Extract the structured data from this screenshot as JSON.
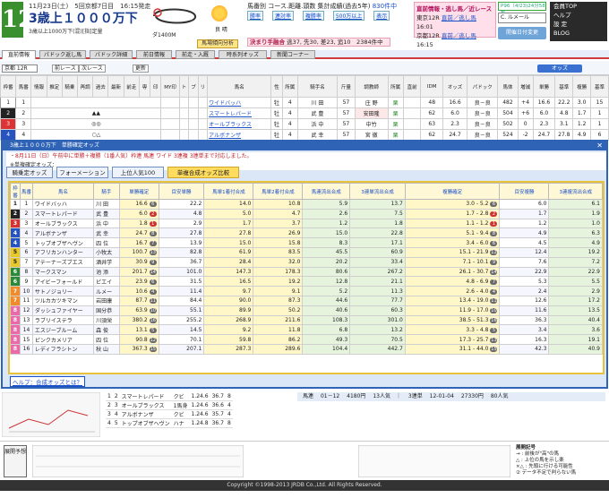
{
  "header": {
    "race_number": "12",
    "date_line": "11月23日(土)　5回京都7日目　16:15発走",
    "race_name": "3歳上１０００万下",
    "condition": "3歳以上1000万下(混)[指]定量",
    "distance": "ダ1400M",
    "track_state": "良 晴",
    "analysis_button": "馬場傾向分析",
    "info_title_prefix": "馬番別 コース.距離.頭数 集計成績(過去5年)",
    "info_link": "830件中",
    "info_buttons": [
      "勝率",
      "連対率",
      "複勝率",
      "500万以上",
      "表示"
    ],
    "rules": "",
    "kimarite_label": "決まり手融合",
    "kimarite_text": "逃37, 先30, 差23, 追10　2384件中",
    "next_race_title": "直前情報・逃し馬／近レース",
    "next_races": [
      {
        "venue": "東京12R",
        "link": "直前／逃し馬",
        "time": "16:01"
      },
      {
        "venue": "京都12R",
        "link": "直前／逃し馬",
        "time": "16:15"
      }
    ],
    "timer": "P96（4/23)24分58秒",
    "user_select": "C. ルメール",
    "kaisai_button": "開催日付変更",
    "side_buttons": [
      "会員TOP",
      "ヘルプ",
      "設 定",
      "BLOG"
    ]
  },
  "tabs": [
    "直前情報",
    "パドック返し馬",
    "パドック詳細",
    "前日情報",
    "前走・入厩",
    "時系列オッズ",
    "新聞コーナー"
  ],
  "subbar": {
    "venue": "京都 12R",
    "prev": "前レース",
    "next": "次レース",
    "update": "更新",
    "odds": "オッズ"
  },
  "main_headers": [
    "枠番",
    "馬番",
    "情報",
    "推定",
    "騎乗",
    "再調",
    "過去",
    "最新",
    "前走",
    "専",
    "印",
    "MY印",
    "ト",
    "ブ",
    "リ",
    "馬名",
    "性",
    "所属",
    "騎手名",
    "斤量",
    "調教師",
    "所属",
    "直前",
    "IDM",
    "オッズ",
    "パドック",
    "馬体",
    "増減",
    "単勝",
    "基準",
    "複勝",
    "基準"
  ],
  "main_rows": [
    {
      "waku": "1",
      "uma": "1",
      "marks": "",
      "name": "ワイドバッハ",
      "sex": "牡",
      "shozoku": "4",
      "jockey": "川 田",
      "weight": "57",
      "trainer": "庄 野",
      "tb": "栗",
      "idm": "48",
      "odds": "16.6",
      "pad": "良－良",
      "bodyw": "482",
      "diff": "+4",
      "tan": "16.6",
      "kijun": "22.2",
      "fuku": "3.0",
      "kfuku": "15"
    },
    {
      "waku": "2",
      "uma": "2",
      "marks": "▲▲",
      "name": "スマートレパード",
      "sex": "牡",
      "shozoku": "4",
      "jockey": "武 豊",
      "weight": "57",
      "trainer": "安田隆",
      "tb": "栗",
      "idm": "62",
      "odds": "6.0",
      "pad": "良－良",
      "bodyw": "504",
      "diff": "+6",
      "tan": "6.0",
      "kijun": "4.8",
      "fuku": "1.7",
      "kfuku": "1"
    },
    {
      "waku": "3",
      "uma": "3",
      "marks": "◎◎",
      "name": "オールブラックス",
      "sex": "牡",
      "shozoku": "4",
      "jockey": "浜 中",
      "weight": "57",
      "trainer": "中竹",
      "tb": "栗",
      "idm": "63",
      "odds": "2.3",
      "pad": "良－良",
      "bodyw": "502",
      "diff": "0",
      "tan": "2.3",
      "kijun": "3.1",
      "fuku": "1.2",
      "kfuku": "1"
    },
    {
      "waku": "4",
      "uma": "4",
      "marks": "○△",
      "name": "アルボナンザ",
      "sex": "牡",
      "shozoku": "4",
      "jockey": "武 幸",
      "weight": "57",
      "trainer": "宮 徹",
      "tb": "栗",
      "idm": "62",
      "odds": "24.7",
      "pad": "良－良",
      "bodyw": "524",
      "diff": "-2",
      "tan": "24.7",
      "kijun": "27.8",
      "fuku": "4.9",
      "kfuku": "6"
    }
  ],
  "panel": {
    "title": "3歳上１０００万下　単勝確定オッズ",
    "info_line_a": "・8月11日（日）午前中に単勝＋複勝（1番人気）枠連 馬連 ワイド 3連複 3連単まで対応しました。",
    "info_line_b": "※単複確定オッズ：",
    "tabs": [
      "騎乗定オッズ",
      "フォーメーション",
      "上位人気100",
      "単複合成オッズ比較"
    ],
    "help": "ヘルプ：合成オッズとは？"
  },
  "grid": {
    "headers": [
      "枠番",
      "馬番",
      "馬名",
      "騎手",
      "単勝確定",
      "目安単勝",
      "馬単1着付合成",
      "馬単2着付合成",
      "馬連流出合成",
      "3連単流出合成",
      "複勝確定",
      "目安複勝",
      "3連複流出合成"
    ],
    "rows": [
      {
        "w": "1",
        "u": "1",
        "name": "ワイドバッハ",
        "jockey": "川 田",
        "tan": "16.6",
        "mrk1": "6",
        "mt": "22.2",
        "mb1": "14.0",
        "mr1": "5",
        "mb2": "10.8",
        "mr2": "6",
        "ren": "5.9",
        "rr": "6",
        "s3": "13.7",
        "fk": "3.0 - 5.2",
        "fr": "6",
        "mf": "6.0",
        "s3f": "6.1",
        "frr": "6"
      },
      {
        "w": "2",
        "u": "2",
        "name": "スマートレパード",
        "jockey": "武 豊",
        "tan": "6.0",
        "mrk1": "2",
        "mt": "4.8",
        "mb1": "5.0",
        "mr1": "2",
        "mb2": "4.7",
        "mr2": "3",
        "ren": "2.6",
        "rr": "2",
        "s3": "7.5",
        "fk": "1.7 - 2.8",
        "fr": "2",
        "mf": "1.7",
        "s3f": "1.9",
        "frr": "3"
      },
      {
        "w": "3",
        "u": "3",
        "name": "オールブラックス",
        "jockey": "浜 中",
        "tan": "1.8",
        "mrk1": "1",
        "mt": "2.9",
        "mb1": "1.7",
        "mr1": "1",
        "mb2": "3.7",
        "mr2": "1",
        "ren": "1.2",
        "rr": "1",
        "s3": "1.8",
        "fk": "1.1 - 1.2",
        "fr": "1",
        "mf": "1.2",
        "s3f": "1.0",
        "frr": "1"
      },
      {
        "w": "4",
        "u": "4",
        "name": "アルボナンザ",
        "jockey": "武 幸",
        "tan": "24.7",
        "mrk1": "8",
        "mt": "27.8",
        "mb1": "27.8",
        "mr1": "8",
        "mb2": "26.9",
        "mr2": "9",
        "ren": "15.0",
        "rr": "8",
        "s3": "22.8",
        "fk": "5.1 - 9.4",
        "fr": "8",
        "mf": "4.9",
        "s3f": "6.3",
        "frr": "6"
      },
      {
        "w": "4",
        "u": "5",
        "name": "トップオブザヘヴン",
        "jockey": "四 位",
        "tan": "16.7",
        "mrk1": "7",
        "mt": "13.9",
        "mb1": "15.0",
        "mr1": "6",
        "mb2": "15.8",
        "mr2": "6",
        "ren": "8.3",
        "rr": "7",
        "s3": "17.1",
        "fk": "3.4 - 6.0",
        "fr": "6",
        "mf": "4.5",
        "s3f": "4.9",
        "frr": "7"
      },
      {
        "w": "5",
        "u": "6",
        "name": "アフリカンハンター",
        "jockey": "小牧太",
        "tan": "100.7",
        "mrk1": "13",
        "mt": "82.8",
        "mb1": "61.9",
        "mr1": "12",
        "mb2": "83.5",
        "mr2": "13",
        "ren": "45.5",
        "rr": "13",
        "s3": "60.9",
        "fk": "15.1 - 21.9",
        "fr": "12",
        "mf": "12.4",
        "s3f": "19.2",
        "frr": "13"
      },
      {
        "w": "5",
        "u": "7",
        "name": "アテーナーズブエス",
        "jockey": "酒井学",
        "tan": "30.9",
        "mrk1": "9",
        "mt": "36.7",
        "mb1": "28.4",
        "mr1": "9",
        "mb2": "32.0",
        "mr2": "10",
        "ren": "20.2",
        "rr": "10",
        "s3": "33.4",
        "fk": "7.1 - 10.1",
        "fr": "9",
        "mf": "7.6",
        "s3f": "7.2",
        "frr": "9"
      },
      {
        "w": "6",
        "u": "8",
        "name": "マークスマン",
        "jockey": "池 添",
        "tan": "201.7",
        "mrk1": "14",
        "mt": "101.0",
        "mb1": "147.3",
        "mr1": "14",
        "mb2": "178.3",
        "mr2": "14",
        "ren": "80.6",
        "rr": "14",
        "s3": "267.2",
        "fk": "26.1 - 30.7",
        "fr": "14",
        "mf": "22.9",
        "s3f": "22.9",
        "frr": "14"
      },
      {
        "w": "6",
        "u": "9",
        "name": "アイビーフォールド",
        "jockey": "ピエイ",
        "tan": "23.9",
        "mrk1": "6",
        "mt": "31.5",
        "mb1": "16.5",
        "mr1": "7",
        "mb2": "19.2",
        "mr2": "8",
        "ren": "12.8",
        "rr": "8",
        "s3": "21.1",
        "fk": "4.8 - 6.9",
        "fr": "7",
        "mf": "5.3",
        "s3f": "5.5",
        "frr": "7"
      },
      {
        "w": "7",
        "u": "10",
        "name": "サトノジョリー",
        "jockey": "ルメー",
        "tan": "10.6",
        "mrk1": "4",
        "mt": "11.4",
        "mb1": "9.7",
        "mr1": "4",
        "mb2": "9.1",
        "mr2": "4",
        "ren": "5.2",
        "rr": "4",
        "s3": "11.3",
        "fk": "2.6 - 4.0",
        "fr": "4",
        "mf": "2.4",
        "s3f": "2.9",
        "frr": "4"
      },
      {
        "w": "7",
        "u": "11",
        "name": "ツルカカツキマン",
        "jockey": "岩田康",
        "tan": "87.7",
        "mrk1": "11",
        "mt": "84.4",
        "mb1": "90.0",
        "mr1": "11",
        "mb2": "87.3",
        "mr2": "12",
        "ren": "44.6",
        "rr": "11",
        "s3": "77.7",
        "fk": "13.4 - 19.0",
        "fr": "11",
        "mf": "12.6",
        "s3f": "17.2",
        "frr": "12"
      },
      {
        "w": "8",
        "u": "12",
        "name": "ダッシュファイヤー",
        "jockey": "国分恭",
        "tan": "63.9",
        "mrk1": "10",
        "mt": "55.1",
        "mb1": "89.9",
        "mr1": "10",
        "mb2": "50.2",
        "mr2": "11",
        "ren": "40.6",
        "rr": "10",
        "s3": "60.3",
        "fk": "11.9 - 17.0",
        "fr": "10",
        "mf": "11.6",
        "s3f": "13.5",
        "frr": "10"
      },
      {
        "w": "8",
        "u": "13",
        "name": "ラブリイステラ",
        "jockey": "川須栄",
        "tan": "380.2",
        "mrk1": "16",
        "mt": "255.2",
        "mb1": "268.9",
        "mr1": "16",
        "mb2": "211.6",
        "mr2": "16",
        "ren": "108.3",
        "rr": "16",
        "s3": "301.0",
        "fk": "38.5 - 51.3",
        "fr": "16",
        "mf": "36.3",
        "s3f": "40.4",
        "frr": "16"
      },
      {
        "w": "8",
        "u": "14",
        "name": "エスジーブルーム",
        "jockey": "森 俊",
        "tan": "13.1",
        "mrk1": "5",
        "mt": "14.5",
        "mb1": "9.2",
        "mr1": "5",
        "mb2": "11.8",
        "mr2": "5",
        "ren": "6.8",
        "rr": "5",
        "s3": "13.2",
        "fk": "3.3 - 4.8",
        "fr": "5",
        "mf": "3.4",
        "s3f": "3.6",
        "frr": "5"
      },
      {
        "w": "8",
        "u": "15",
        "name": "ピンクカメリア",
        "jockey": "四 位",
        "tan": "90.8",
        "mrk1": "12",
        "mt": "70.1",
        "mb1": "59.8",
        "mr1": "13",
        "mb2": "86.2",
        "mr2": "13",
        "ren": "49.3",
        "rr": "12",
        "s3": "70.5",
        "fk": "17.3 - 25.7",
        "fr": "13",
        "mf": "16.3",
        "s3f": "19.1",
        "frr": "13"
      },
      {
        "w": "8",
        "u": "16",
        "name": "レディフラシトン",
        "jockey": "秋 山",
        "tan": "367.3",
        "mrk1": "15",
        "mt": "207.1",
        "mb1": "287.3",
        "mr1": "16",
        "mb2": "289.6",
        "mr2": "15",
        "ren": "104.4",
        "rr": "15",
        "s3": "442.7",
        "fk": "31.1 - 44.0",
        "fr": "15",
        "mf": "42.3",
        "s3f": "40.9",
        "frr": "15"
      }
    ]
  },
  "lower": {
    "mini": [
      {
        "n": "1",
        "u": "2",
        "name": "スマートレパード",
        "kind": "クビ",
        "t": "1.24.6",
        "s": "36.7",
        "r": "8"
      },
      {
        "n": "2",
        "u": "3",
        "name": "オールブラックス",
        "kind": "1馬身",
        "t": "1.24.6",
        "s": "36.6",
        "r": "4"
      },
      {
        "n": "3",
        "u": "4",
        "name": "アルボナンザ",
        "kind": "クビ",
        "t": "1.24.6",
        "s": "35.7",
        "r": "4"
      },
      {
        "n": "4",
        "u": "5",
        "name": "トップオブザヘヴン",
        "kind": "ハナ",
        "t": "1.24.8",
        "s": "36.7",
        "r": "8"
      }
    ],
    "stats_a": {
      "label": "馬連",
      "range": "01－12",
      "value": "4180円",
      "pop": "13人気"
    },
    "stats_b": {
      "label": "3連単",
      "range": "12-01-04",
      "value": "27330円",
      "pop": "80人気"
    }
  },
  "bottom": {
    "tenkai": "展開予想",
    "legend_title": "展開記号",
    "legend": [
      "→ : 前後が\"高\"の馬",
      "△ : 上位の馬を示し楽",
      "×△ : 先頭に行ける可能性",
      "② データ不足で判らない馬",
      "（データ不足の際、変動の場合有り）"
    ]
  },
  "footer": "Copyright ©1998-2013 JRDB Co.,Ltd. All Rights Reserved."
}
